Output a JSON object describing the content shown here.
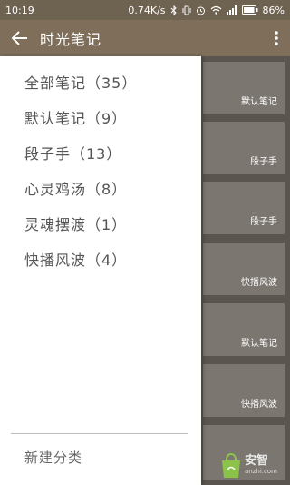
{
  "status_bar": {
    "time": "10:19",
    "network_speed": "0.74K/s",
    "battery": "86%",
    "icons": [
      "bluetooth-icon",
      "vibrate-icon",
      "alarm-icon",
      "wifi-icon",
      "signal-icon",
      "battery-icon"
    ]
  },
  "app_bar": {
    "title": "时光笔记",
    "back_icon": "arrow-left-icon",
    "menu_icon": "more-vert-icon"
  },
  "drawer": {
    "items": [
      {
        "label": "全部笔记（35）"
      },
      {
        "label": "默认笔记（9）"
      },
      {
        "label": "段子手（13）"
      },
      {
        "label": "心灵鸡汤（8）"
      },
      {
        "label": "灵魂摆渡（1）"
      },
      {
        "label": "快播风波（4）"
      }
    ],
    "new_category_label": "新建分类"
  },
  "notes": [
    {
      "category": "默认笔记"
    },
    {
      "category": "段子手"
    },
    {
      "category": "段子手"
    },
    {
      "category": "快播风波"
    },
    {
      "category": "默认笔记"
    },
    {
      "category": "快播风波"
    }
  ],
  "watermark": {
    "main": "安智",
    "sub": "anzhi.com"
  },
  "colors": {
    "app_bar": "#7e6e5a",
    "status_bar": "#6e6251",
    "drawer_bg": "#ffffff",
    "drawer_text": "#555555",
    "card_bg": "#7b7670"
  }
}
